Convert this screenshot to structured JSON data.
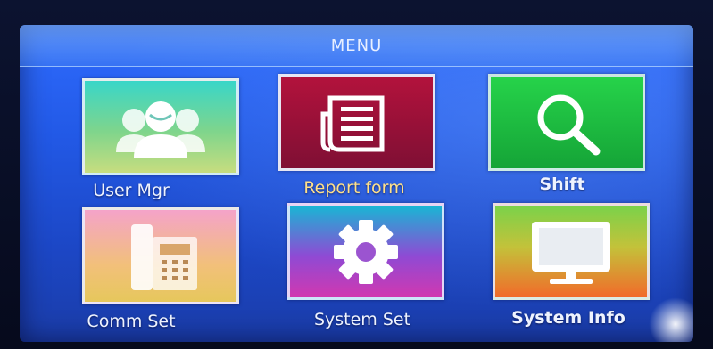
{
  "screen": {
    "title": "MENU"
  },
  "menu": {
    "items": [
      {
        "label": "User Mgr",
        "icon": "users-icon",
        "color": "#39d6c8"
      },
      {
        "label": "Report form",
        "icon": "document-icon",
        "color": "#9b1038"
      },
      {
        "label": "Shift",
        "icon": "magnifier-icon",
        "color": "#22c640"
      },
      {
        "label": "Comm Set",
        "icon": "telephone-icon",
        "color": "#f2c07a"
      },
      {
        "label": "System Set",
        "icon": "gear-icon",
        "color": "#8f4ad4"
      },
      {
        "label": "System Info",
        "icon": "monitor-icon",
        "color": "#f26a2a"
      }
    ],
    "selected": "Report form"
  }
}
